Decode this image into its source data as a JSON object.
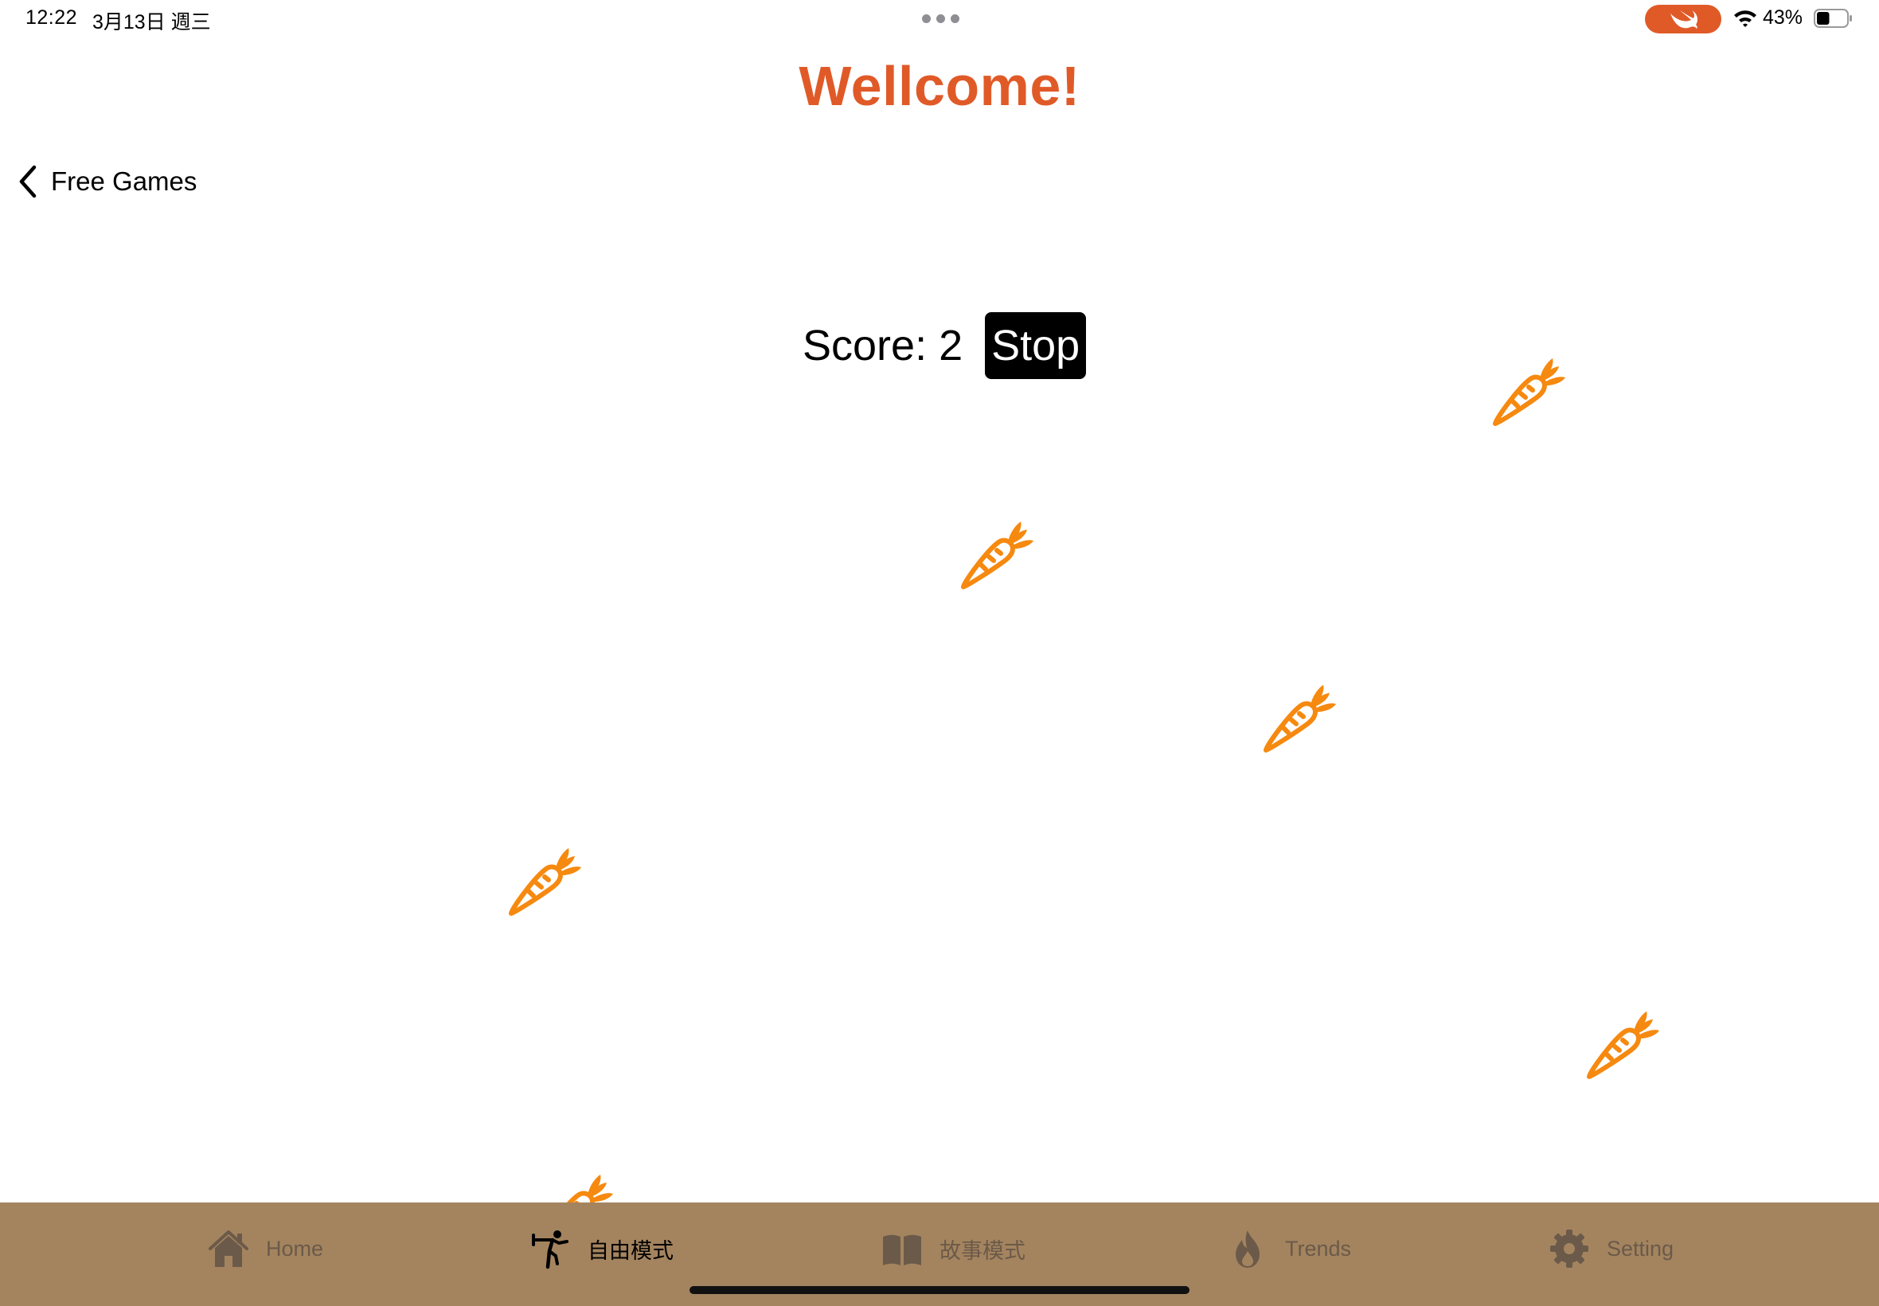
{
  "status_bar": {
    "time": "12:22",
    "date": "3月13日 週三",
    "battery_percent": "43%",
    "battery_level": 0.43,
    "swift_pill_color": "#e05a28"
  },
  "header": {
    "title": "Wellcome!",
    "title_color": "#e05a28",
    "back_label": "Free Games"
  },
  "game": {
    "score_label": "Score: 2",
    "stop_label": "Stop",
    "item_icon": "carrot-icon",
    "item_color": "#f6890f",
    "carrot_count": 6
  },
  "tab_bar": {
    "background": "#a4845f",
    "tabs": [
      {
        "label": "Home",
        "icon": "house-icon",
        "active": false
      },
      {
        "label": "自由模式",
        "icon": "figure-kick-icon",
        "active": true
      },
      {
        "label": "故事模式",
        "icon": "book-icon",
        "active": false
      },
      {
        "label": "Trends",
        "icon": "flame-icon",
        "active": false
      },
      {
        "label": "Setting",
        "icon": "gear-icon",
        "active": false
      }
    ]
  }
}
